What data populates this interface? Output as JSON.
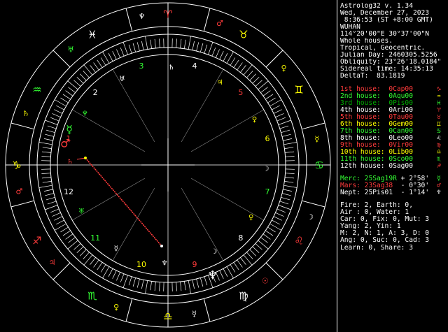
{
  "app_title": "Astrolog32 v. 1.34",
  "chart_info": [
    {
      "text": "Wed, December 27, 2023",
      "color": "#ffffff"
    },
    {
      "text": " 8:36:53 (ST +8:00 GMT)",
      "color": "#ffffff"
    },
    {
      "text": "WUHAN",
      "color": "#ffffff"
    },
    {
      "text": "114°20'00\"E 30°37'00\"N",
      "color": "#ffffff"
    },
    {
      "text": "Whole houses.",
      "color": "#ffffff"
    },
    {
      "text": "Tropical, Geocentric.",
      "color": "#ffffff"
    },
    {
      "text": "Julian Day: 2460305.5256",
      "color": "#ffffff"
    },
    {
      "text": "Obliquity: 23°26'18.0184\"",
      "color": "#ffffff"
    },
    {
      "text": "Sidereal time: 14:35:13",
      "color": "#ffffff"
    },
    {
      "text": "DeltaT:  83.1819",
      "color": "#ffffff"
    }
  ],
  "house_cusps": [
    {
      "house": "1st house:",
      "pos": "0Cap00",
      "color": "#ff3b3b",
      "sign_glyph": "♑",
      "sign_color": "#ff3b3b"
    },
    {
      "house": "2nd house:",
      "pos": "0Aqu00",
      "color": "#33ff33",
      "sign_glyph": "♒",
      "sign_color": "#ffff00"
    },
    {
      "house": "3rd house:",
      "pos": "0Pis00",
      "color": "#00aa00",
      "sign_glyph": "♓",
      "sign_color": "#33ff33"
    },
    {
      "house": "4th house:",
      "pos": "0Ari00",
      "color": "#ffffff",
      "sign_glyph": "♈",
      "sign_color": "#ff3b3b"
    },
    {
      "house": "5th house:",
      "pos": "0Tau00",
      "color": "#ff3b3b",
      "sign_glyph": "♉",
      "sign_color": "#ff3b3b"
    },
    {
      "house": "6th house:",
      "pos": "0Gem00",
      "color": "#ffff00",
      "sign_glyph": "♊",
      "sign_color": "#ffff00"
    },
    {
      "house": "7th house:",
      "pos": "0Can00",
      "color": "#33ff33",
      "sign_glyph": "♋",
      "sign_color": "#33ff33"
    },
    {
      "house": "8th house:",
      "pos": "0Leo00",
      "color": "#ffffff",
      "sign_glyph": "♌",
      "sign_color": "#ffffff"
    },
    {
      "house": "9th house:",
      "pos": "0Vir00",
      "color": "#ff3b3b",
      "sign_glyph": "♍",
      "sign_color": "#ff3b3b"
    },
    {
      "house": "10th house:",
      "pos": "0Lib00",
      "color": "#ffff00",
      "sign_glyph": "♎",
      "sign_color": "#ffff00"
    },
    {
      "house": "11th house:",
      "pos": "0Sco00",
      "color": "#33ff33",
      "sign_glyph": "♏",
      "sign_color": "#33ff33"
    },
    {
      "house": "12th house:",
      "pos": "0Sag00",
      "color": "#ffffff",
      "sign_glyph": "♐",
      "sign_color": "#ff3b3b"
    }
  ],
  "planets": [
    {
      "name": "Merc:",
      "pos": "25Sag19R",
      "extra": "+ 2°58'",
      "color": "#33ff33",
      "glyph": "☿",
      "glyph_color": "#33ff33"
    },
    {
      "name": "Mars:",
      "pos": "23Sag38",
      "extra": " - 0°30'",
      "color": "#ff3b3b",
      "glyph": "♂",
      "glyph_color": "#ff3b3b"
    },
    {
      "name": "Nept:",
      "pos": "25Pis01",
      "extra": " - 1°14'",
      "color": "#ffffff",
      "glyph": "♆",
      "glyph_color": "#ffffff"
    }
  ],
  "element_summary": [
    "Fire: 2, Earth: 0,",
    "Air : 0, Water: 1",
    "Car: 0, Fix: 0, Mut: 3",
    "Yang: 2, Yin: 1",
    "M: 2, N: 1, A: 3, D: 0",
    "Ang: 0, Suc: 0, Cad: 3",
    "Learn: 0, Share: 3"
  ],
  "wheel": {
    "house_numbers": [
      {
        "label": "1",
        "color": "#ff3b3b"
      },
      {
        "label": "2",
        "color": "#ffffff"
      },
      {
        "label": "3",
        "color": "#33ff33"
      },
      {
        "label": "4",
        "color": "#ffffff"
      },
      {
        "label": "5",
        "color": "#ff3b3b"
      },
      {
        "label": "6",
        "color": "#ffff00"
      },
      {
        "label": "7",
        "color": "#33ff33"
      },
      {
        "label": "8",
        "color": "#ffffff"
      },
      {
        "label": "9",
        "color": "#ff3b3b"
      },
      {
        "label": "10",
        "color": "#ffff00"
      },
      {
        "label": "11",
        "color": "#33ff33"
      },
      {
        "label": "12",
        "color": "#ffffff"
      }
    ],
    "sign_glyphs": [
      {
        "glyph": "♑",
        "color": "#ffff00"
      },
      {
        "glyph": "♒",
        "color": "#33ff33"
      },
      {
        "glyph": "♓",
        "color": "#ffffff"
      },
      {
        "glyph": "♈",
        "color": "#ff3b3b"
      },
      {
        "glyph": "♉",
        "color": "#ffff00"
      },
      {
        "glyph": "♊",
        "color": "#ffff00"
      },
      {
        "glyph": "♋",
        "color": "#33ff33"
      },
      {
        "glyph": "♌",
        "color": "#ff3b3b"
      },
      {
        "glyph": "♍",
        "color": "#ffffff"
      },
      {
        "glyph": "♎",
        "color": "#ffff00"
      },
      {
        "glyph": "♏",
        "color": "#33ff33"
      },
      {
        "glyph": "♐",
        "color": "#ff3b3b"
      }
    ],
    "ruler_glyphs": [
      {
        "glyph": "♂",
        "color": "#ff3b3b"
      },
      {
        "glyph": "♄",
        "color": "#ffff00"
      },
      {
        "glyph": "♅",
        "color": "#33ff33"
      },
      {
        "glyph": "♆",
        "color": "#ffffff"
      },
      {
        "glyph": "♂",
        "color": "#ff3b3b"
      },
      {
        "glyph": "♀",
        "color": "#ffff00"
      },
      {
        "glyph": "☿",
        "color": "#ffff00"
      },
      {
        "glyph": "☽",
        "color": "#ffffff"
      },
      {
        "glyph": "☉",
        "color": "#ff3b3b"
      },
      {
        "glyph": "☿",
        "color": "#ffffff"
      },
      {
        "glyph": "♀",
        "color": "#ffff00"
      },
      {
        "glyph": "♃",
        "color": "#ff3b3b"
      }
    ],
    "inner_glyphs": [
      {
        "glyph": "♄",
        "color": "#ff3b3b"
      },
      {
        "glyph": "♆",
        "color": "#33ff33"
      },
      {
        "glyph": "♅",
        "color": "#ffffff"
      },
      {
        "glyph": "♄",
        "color": "#ffffff"
      },
      {
        "glyph": "♃",
        "color": "#ffff00"
      },
      {
        "glyph": "♀",
        "color": "#ffff00"
      },
      {
        "glyph": "☽",
        "color": "#ffffff"
      },
      {
        "glyph": "♀",
        "color": "#ffff00"
      },
      {
        "glyph": "☽",
        "color": "#ffffff"
      },
      {
        "glyph": "♆",
        "color": "#ffffff"
      },
      {
        "glyph": "☿",
        "color": "#ffffff"
      },
      {
        "glyph": "♅",
        "color": "#33ff33"
      }
    ],
    "planet_markers": [
      {
        "glyph": "♂",
        "color": "#ff3b3b"
      },
      {
        "glyph": "☿",
        "color": "#33ff33"
      },
      {
        "glyph": "♆",
        "color": "#ffffff"
      }
    ],
    "aspect_line_color": "#ff3b3b",
    "circle_color": "#ffffff",
    "spoke_color": "#8a8a8a"
  }
}
